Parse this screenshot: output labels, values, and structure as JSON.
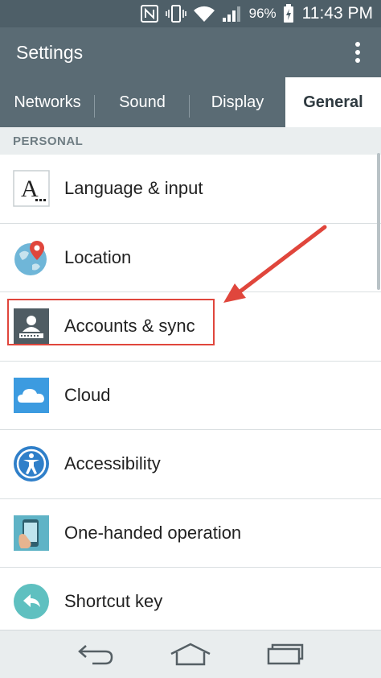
{
  "status_bar": {
    "battery_percent": "96%",
    "time": "11:43 PM",
    "icons": [
      "nfc-icon",
      "vibrate-icon",
      "wifi-icon",
      "signal-icon",
      "battery-charging-icon"
    ]
  },
  "app_bar": {
    "title": "Settings",
    "menu_icon": "overflow-menu-icon"
  },
  "tabs": [
    {
      "label": "Networks",
      "active": false
    },
    {
      "label": "Sound",
      "active": false
    },
    {
      "label": "Display",
      "active": false
    },
    {
      "label": "General",
      "active": true
    }
  ],
  "section": {
    "header": "PERSONAL"
  },
  "items": [
    {
      "label": "Language & input",
      "icon": "language-input-icon"
    },
    {
      "label": "Location",
      "icon": "location-globe-icon"
    },
    {
      "label": "Accounts & sync",
      "icon": "accounts-sync-icon",
      "highlighted": true
    },
    {
      "label": "Cloud",
      "icon": "cloud-icon"
    },
    {
      "label": "Accessibility",
      "icon": "accessibility-icon"
    },
    {
      "label": "One-handed operation",
      "icon": "one-handed-icon"
    },
    {
      "label": "Shortcut key",
      "icon": "shortcut-key-icon"
    }
  ],
  "nav_bar": {
    "buttons": [
      "back-icon",
      "home-icon",
      "recent-apps-icon"
    ]
  },
  "colors": {
    "header_bg": "#5a6b74",
    "status_bg": "#4e5f68",
    "highlight_red": "#e0463c",
    "section_bg": "#eaeeef"
  }
}
